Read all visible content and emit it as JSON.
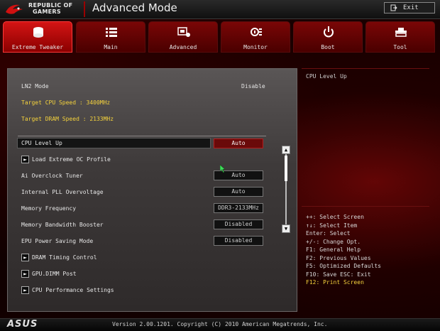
{
  "brand": {
    "line1": "REPUBLIC OF",
    "line2": "GAMERS"
  },
  "title": "Advanced Mode",
  "exit_label": "Exit",
  "tabs": [
    {
      "label": "Extreme Tweaker",
      "icon": "extreme-tweaker-icon",
      "active": true
    },
    {
      "label": "Main",
      "icon": "list-icon"
    },
    {
      "label": "Advanced",
      "icon": "advanced-icon"
    },
    {
      "label": "Monitor",
      "icon": "monitor-icon"
    },
    {
      "label": "Boot",
      "icon": "power-icon"
    },
    {
      "label": "Tool",
      "icon": "tool-icon"
    }
  ],
  "settings": {
    "ln2_label": "LN2 Mode",
    "ln2_value": "Disable",
    "target_cpu": "Target CPU Speed : 3400MHz",
    "target_dram": "Target DRAM Speed : 2133MHz",
    "items": [
      {
        "label": "CPU Level Up",
        "value": "Auto"
      },
      {
        "label": "Load Extreme OC Profile",
        "value": null
      },
      {
        "label": "Ai Overclock Tuner",
        "value": "Auto"
      },
      {
        "label": "Internal PLL Overvoltage",
        "value": "Auto"
      },
      {
        "label": "Memory Frequency",
        "value": "DDR3-2133MHz"
      },
      {
        "label": "Memory Bandwidth Booster",
        "value": "Disabled"
      },
      {
        "label": "EPU Power Saving Mode",
        "value": "Disabled"
      },
      {
        "label": "DRAM Timing Control",
        "value": null
      },
      {
        "label": "GPU.DIMM Post",
        "value": null
      },
      {
        "label": "CPU Performance Settings",
        "value": null
      }
    ]
  },
  "help": {
    "title": "CPU Level Up"
  },
  "keys": [
    "++: Select Screen",
    "↑↓: Select Item",
    "Enter: Select",
    "+/-: Change Opt.",
    "F1: General Help",
    "F2: Previous Values",
    "F5: Optimized Defaults",
    "F10: Save  ESC: Exit",
    "F12: Print Screen"
  ],
  "footer": {
    "brand": "ASUS",
    "version": "Version 2.00.1201. Copyright (C) 2010 American Megatrends, Inc."
  },
  "colors": {
    "accent": "#d41414",
    "highlight": "#f4d23c",
    "panel": "#4a4646"
  }
}
